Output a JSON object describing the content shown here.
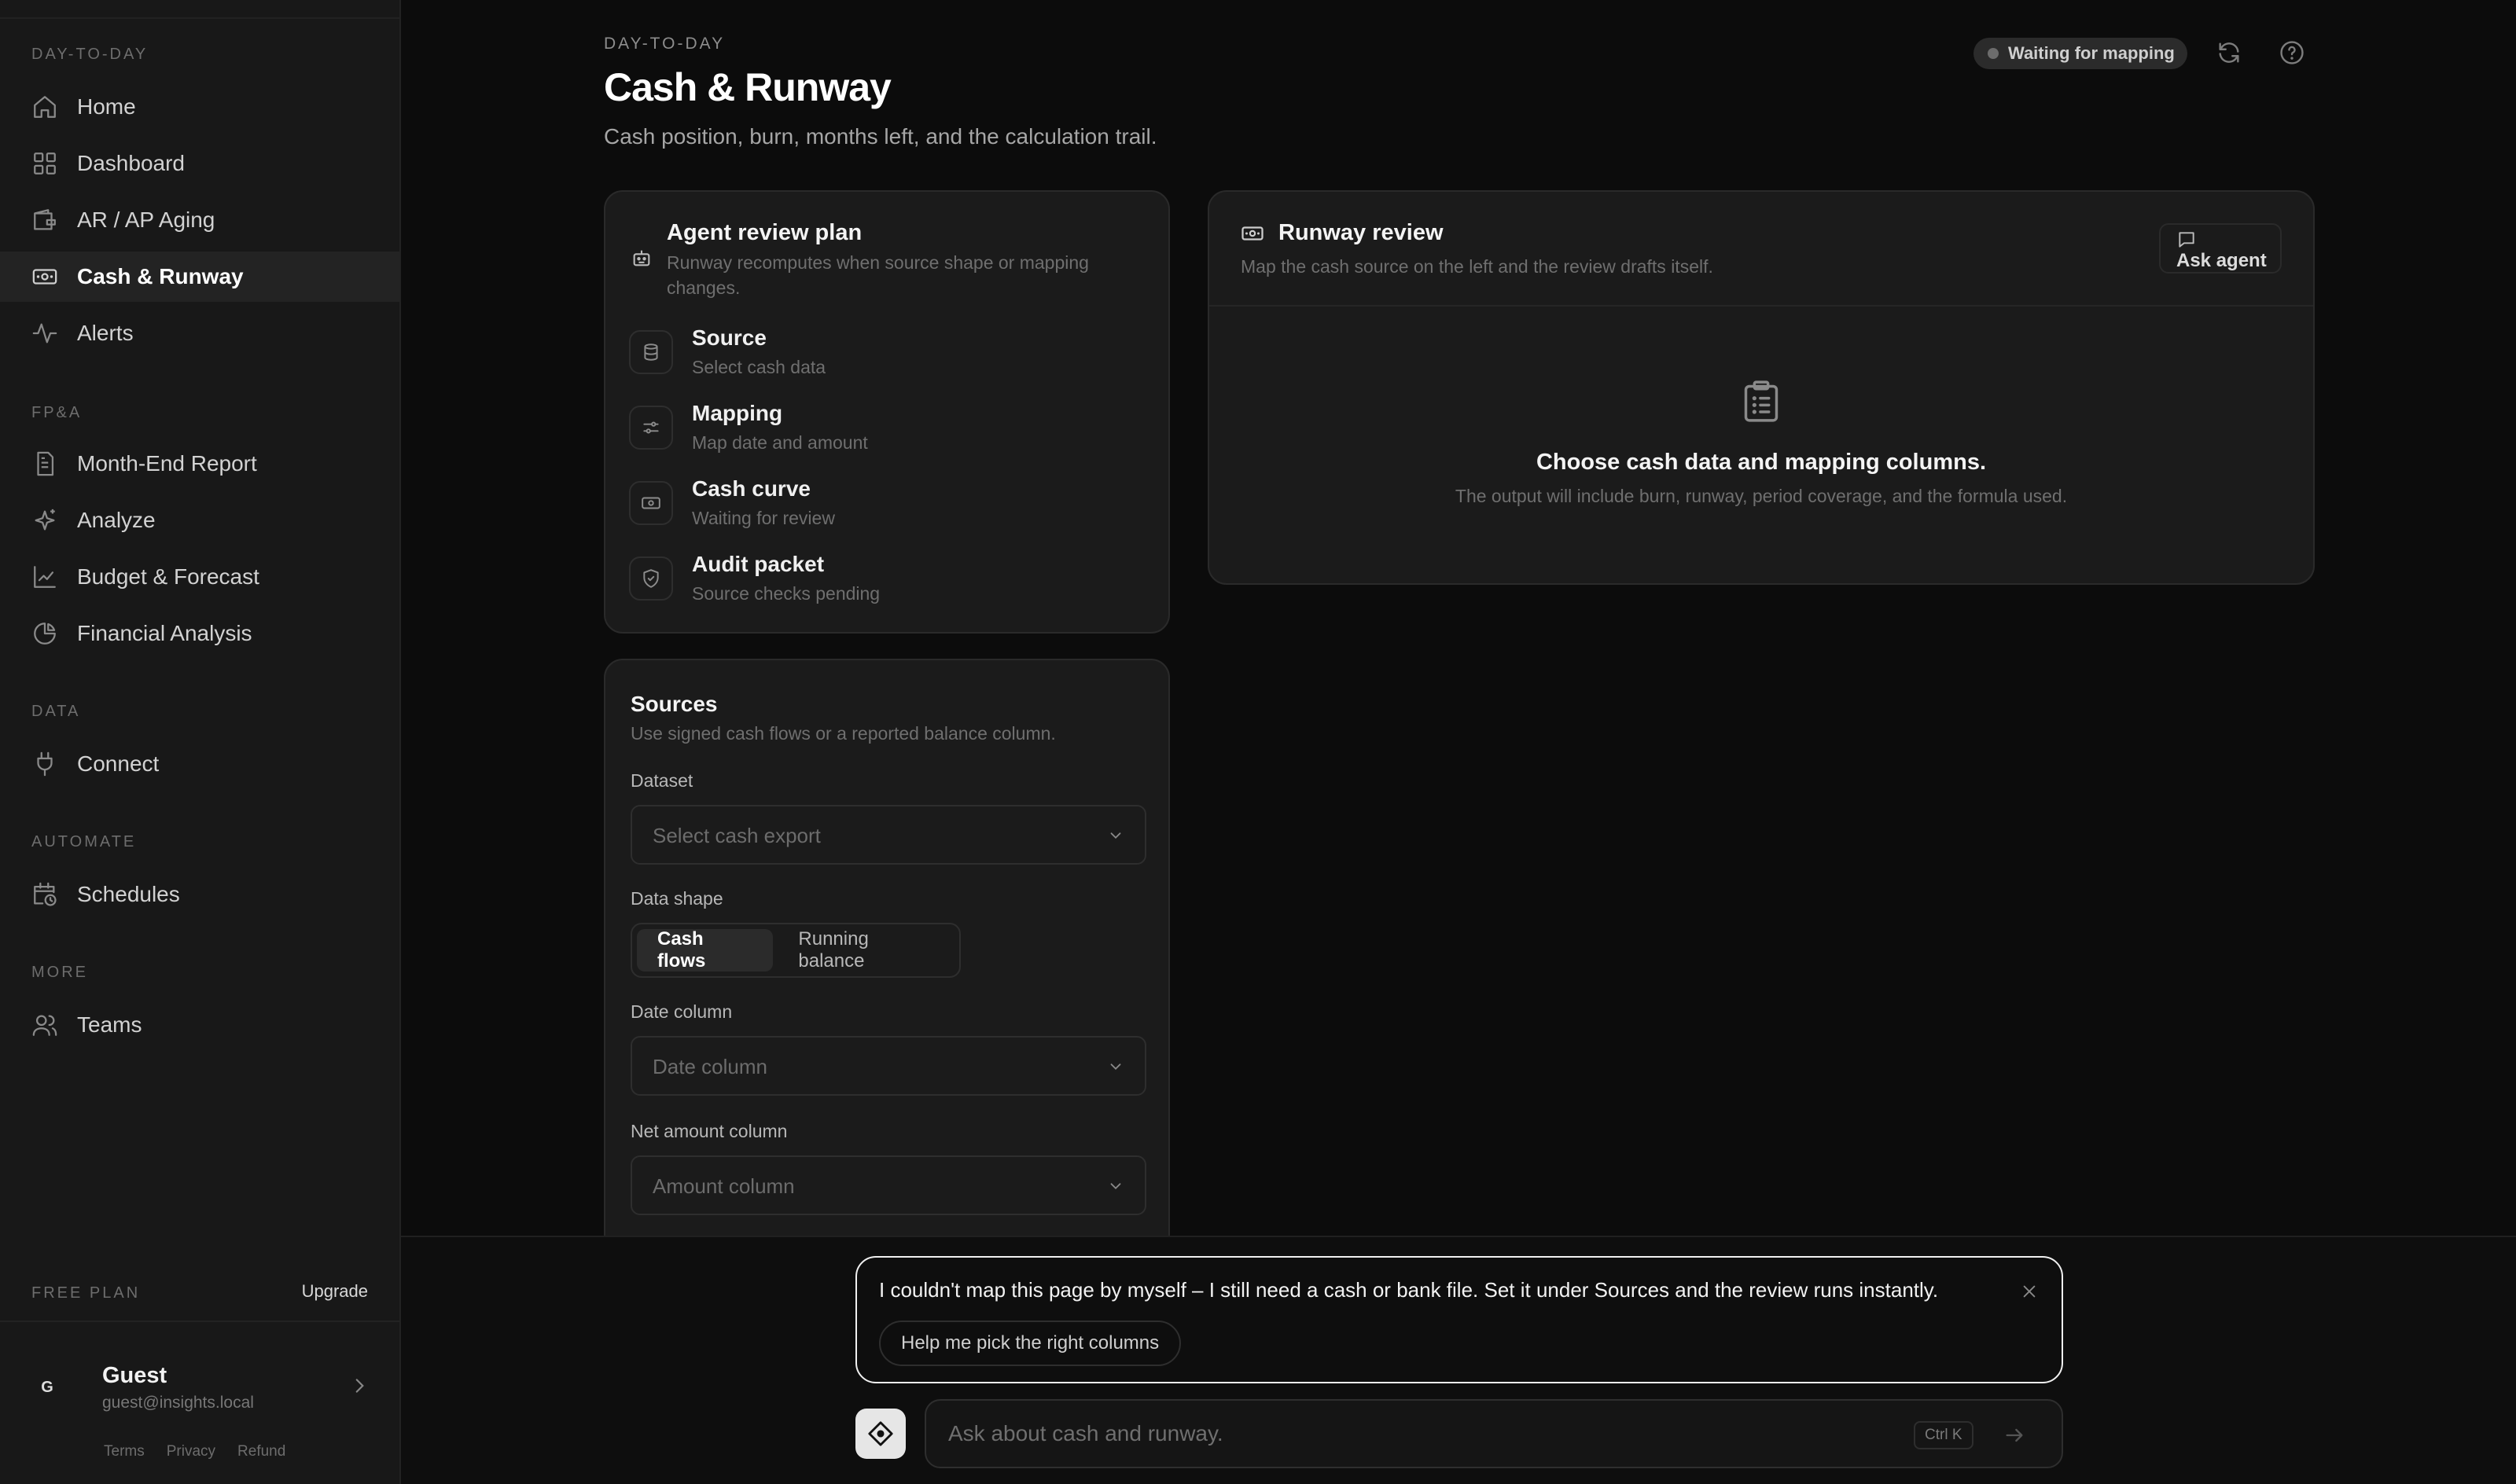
{
  "sidebar": {
    "sections": {
      "day_to_day": "DAY-TO-DAY",
      "fpa": "FP&A",
      "data": "DATA",
      "automate": "AUTOMATE",
      "more": "MORE"
    },
    "items": {
      "home": "Home",
      "dashboard": "Dashboard",
      "aging": "AR / AP Aging",
      "cash": "Cash & Runway",
      "alerts": "Alerts",
      "month_end": "Month-End Report",
      "analyze": "Analyze",
      "budget": "Budget & Forecast",
      "financial": "Financial Analysis",
      "connect": "Connect",
      "schedules": "Schedules",
      "teams": "Teams"
    },
    "plan_label": "FREE PLAN",
    "upgrade_label": "Upgrade",
    "user": {
      "initial": "G",
      "name": "Guest",
      "email": "guest@insights.local"
    },
    "legal": {
      "terms": "Terms",
      "privacy": "Privacy",
      "refund": "Refund"
    }
  },
  "header": {
    "eyebrow": "DAY-TO-DAY",
    "title": "Cash & Runway",
    "subtitle": "Cash position, burn, months left, and the calculation trail.",
    "status": "Waiting for mapping"
  },
  "plan": {
    "title": "Agent review plan",
    "description": "Runway recomputes when source shape or mapping changes.",
    "steps": [
      {
        "title": "Source",
        "subtitle": "Select cash data"
      },
      {
        "title": "Mapping",
        "subtitle": "Map date and amount"
      },
      {
        "title": "Cash curve",
        "subtitle": "Waiting for review"
      },
      {
        "title": "Audit packet",
        "subtitle": "Source checks pending"
      }
    ]
  },
  "review": {
    "title": "Runway review",
    "description": "Map the cash source on the left and the review drafts itself.",
    "ask_agent": "Ask agent",
    "empty_title": "Choose cash data and mapping columns.",
    "empty_desc": "The output will include burn, runway, period coverage, and the formula used."
  },
  "sources": {
    "title": "Sources",
    "description": "Use signed cash flows or a reported balance column.",
    "dataset_label": "Dataset",
    "dataset_value": "Select cash export",
    "shape_label": "Data shape",
    "shape_options": [
      "Cash flows",
      "Running balance"
    ],
    "date_label": "Date column",
    "date_value": "Date column",
    "amount_label": "Net amount column",
    "amount_value": "Amount column"
  },
  "chat": {
    "message": "I couldn't map this page by myself – I still need a cash or bank file. Set it under Sources and the review runs instantly.",
    "suggestion": "Help me pick the right columns",
    "placeholder": "Ask about cash and runway.",
    "shortcut": "Ctrl K"
  },
  "icons": {
    "home": "home-icon",
    "dashboard": "grid-icon",
    "aging": "wallet-icon",
    "cash": "banknote-icon",
    "alerts": "pulse-icon",
    "month_end": "document-icon",
    "analyze": "sparkles-icon",
    "budget": "line-chart-icon",
    "financial": "pie-chart-icon",
    "connect": "plug-icon",
    "schedules": "calendar-clock-icon",
    "teams": "users-icon"
  },
  "colors": {
    "background": "#0c0c0c",
    "sidebar": "#181818",
    "card": "#1b1b1b",
    "active_nav": "#232323",
    "accent": "#ffffff"
  }
}
